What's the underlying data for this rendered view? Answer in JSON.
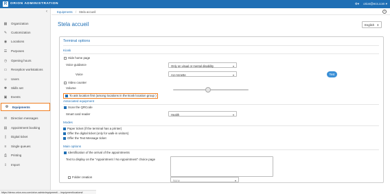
{
  "app": {
    "logo": "R",
    "title": "ORION ADMINISTRATION",
    "user": "orion@ecs.com"
  },
  "sidebar": {
    "items": [
      {
        "label": "Organization",
        "icon": "building-icon"
      },
      {
        "label": "Customization",
        "icon": "pencil-icon"
      },
      {
        "label": "Locations",
        "icon": "pin-icon"
      },
      {
        "label": "Purposes",
        "icon": "list-icon"
      },
      {
        "label": "Opening hours",
        "icon": "clock-icon"
      },
      {
        "label": "Reception workstations",
        "icon": "desk-icon"
      },
      {
        "label": "Users",
        "icon": "users-icon"
      },
      {
        "label": "Skills set",
        "icon": "skills-icon"
      },
      {
        "label": "Events",
        "icon": "calendar-icon"
      },
      {
        "label": "Equipments",
        "icon": "equipment-icon",
        "active": true
      },
      {
        "label": "Direction messages",
        "icon": "message-icon"
      },
      {
        "label": "Appointment booking",
        "icon": "calendar-check-icon"
      },
      {
        "label": "Digital ticket",
        "icon": "ticket-icon"
      },
      {
        "label": "Single queues",
        "icon": "queue-icon"
      },
      {
        "label": "Printing",
        "icon": "printer-icon"
      },
      {
        "label": "Import",
        "icon": "import-icon"
      }
    ]
  },
  "breadcrumb": {
    "parent": "Equipments",
    "current": "Stela accueil"
  },
  "page": {
    "title": "Stela accueil",
    "language": "English"
  },
  "panel": {
    "title": "Terminal options"
  },
  "kiosk": {
    "section": "Kiosk",
    "hide_home_page": "Hide home page",
    "voice_guidance_label": "Voice guidance",
    "voice_guidance_value": "Only on visual or mental disability",
    "voice_label": "Voice",
    "voice_value": "AU-Annette",
    "test_button": "Test",
    "video_counter": "Video counter",
    "volume_label": "Volume",
    "volume_level": 0.46,
    "ask_location": "To ask location first (among locations in the kiosk location group )"
  },
  "associated": {
    "section": "Associated equipment",
    "scan_qr": "Scan the QRCode",
    "smart_card_label": "Smart card reader",
    "smart_card_value": "Health"
  },
  "modes": {
    "section": "Modes",
    "paper_ticket": "Paper ticket (if the terminal has a printer)",
    "digital_ticket": "Offer the digital ticket (only for walk-in visitors)",
    "text_message": "Offer the Text Message ticket"
  },
  "main": {
    "section": "Main options",
    "identification": "Identification of the arrival of the appointments",
    "text_display_label": "Text to display on the \"Appointment / No Appointment\" choice page",
    "folder_creation": "Folder creation",
    "folder_value": "None"
  },
  "status": {
    "url": "https://demo.orion-ecs.com/orion-admin/equipment/..../equipment/custom#"
  }
}
